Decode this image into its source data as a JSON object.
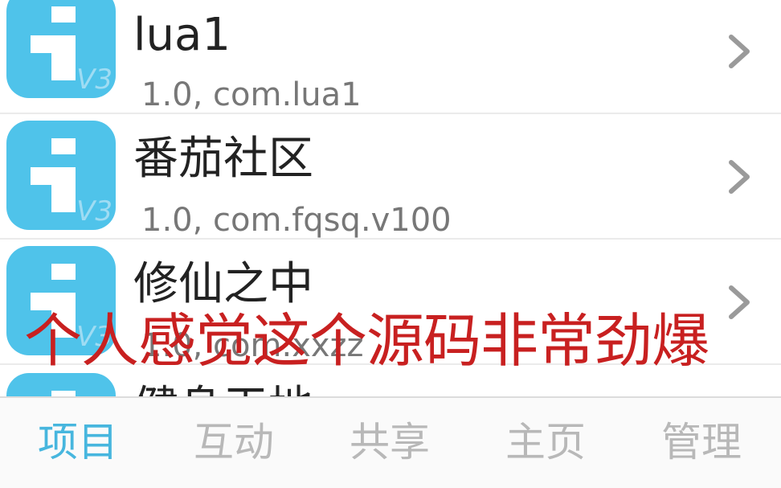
{
  "apps": [
    {
      "title": "lua1",
      "subtitle": "1.0, com.lua1",
      "icon_badge": "V3"
    },
    {
      "title": "番茄社区",
      "subtitle": "1.0, com.fqsq.v100",
      "icon_badge": "V3"
    },
    {
      "title": "修仙之中",
      "subtitle": "1.0, com.xxzz",
      "icon_badge": "V3"
    },
    {
      "title": "健身天地",
      "subtitle": "",
      "icon_badge": ""
    }
  ],
  "overlay_caption": "个人感觉这个源码非常劲爆",
  "tabs": [
    {
      "label": "项目",
      "active": true
    },
    {
      "label": "互动",
      "active": false
    },
    {
      "label": "共享",
      "active": false
    },
    {
      "label": "主页",
      "active": false
    },
    {
      "label": "管理",
      "active": false
    }
  ],
  "colors": {
    "accent": "#47b6de",
    "icon_bg": "#4fc3ea",
    "caption": "#c82020"
  },
  "icons": {
    "app_icon": "info-i-icon",
    "disclosure": "chevron-right-icon"
  }
}
